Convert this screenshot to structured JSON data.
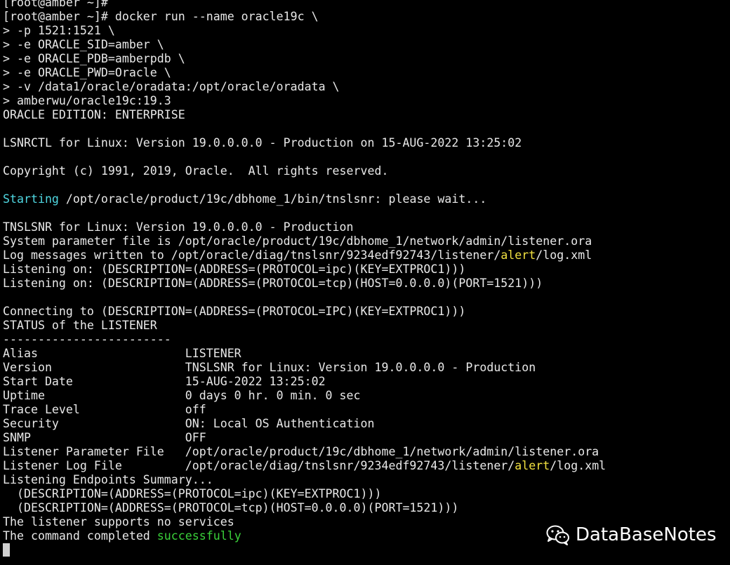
{
  "terminal": {
    "lines": [
      {
        "segments": [
          {
            "text": "[root@amber ~]#",
            "color": "default"
          }
        ]
      },
      {
        "segments": [
          {
            "text": "[root@amber ~]# docker run --name oracle19c \\",
            "color": "default"
          }
        ]
      },
      {
        "segments": [
          {
            "text": "> -p 1521:1521 \\",
            "color": "default"
          }
        ]
      },
      {
        "segments": [
          {
            "text": "> -e ORACLE_SID=amber \\",
            "color": "default"
          }
        ]
      },
      {
        "segments": [
          {
            "text": "> -e ORACLE_PDB=amberpdb \\",
            "color": "default"
          }
        ]
      },
      {
        "segments": [
          {
            "text": "> -e ORACLE_PWD=Oracle \\",
            "color": "default"
          }
        ]
      },
      {
        "segments": [
          {
            "text": "> -v /data1/oracle/oradata:/opt/oracle/oradata \\",
            "color": "default"
          }
        ]
      },
      {
        "segments": [
          {
            "text": "> amberwu/oracle19c:19.3",
            "color": "default"
          }
        ]
      },
      {
        "segments": [
          {
            "text": "ORACLE EDITION: ENTERPRISE",
            "color": "default"
          }
        ]
      },
      {
        "segments": [
          {
            "text": "",
            "color": "default"
          }
        ]
      },
      {
        "segments": [
          {
            "text": "LSNRCTL for Linux: Version 19.0.0.0.0 - Production on 15-AUG-2022 13:25:02",
            "color": "default"
          }
        ]
      },
      {
        "segments": [
          {
            "text": "",
            "color": "default"
          }
        ]
      },
      {
        "segments": [
          {
            "text": "Copyright (c) 1991, 2019, Oracle.  All rights reserved.",
            "color": "default"
          }
        ]
      },
      {
        "segments": [
          {
            "text": "",
            "color": "default"
          }
        ]
      },
      {
        "segments": [
          {
            "text": "Starting",
            "color": "cyan"
          },
          {
            "text": " /opt/oracle/product/19c/dbhome_1/bin/tnslsnr: please wait...",
            "color": "default"
          }
        ]
      },
      {
        "segments": [
          {
            "text": "",
            "color": "default"
          }
        ]
      },
      {
        "segments": [
          {
            "text": "TNSLSNR for Linux: Version 19.0.0.0.0 - Production",
            "color": "default"
          }
        ]
      },
      {
        "segments": [
          {
            "text": "System parameter file is /opt/oracle/product/19c/dbhome_1/network/admin/listener.ora",
            "color": "default"
          }
        ]
      },
      {
        "segments": [
          {
            "text": "Log messages written to /opt/oracle/diag/tnslsnr/9234edf92743/listener/",
            "color": "default"
          },
          {
            "text": "alert",
            "color": "yellow"
          },
          {
            "text": "/log.xml",
            "color": "default"
          }
        ]
      },
      {
        "segments": [
          {
            "text": "Listening on: (DESCRIPTION=(ADDRESS=(PROTOCOL=ipc)(KEY=EXTPROC1)))",
            "color": "default"
          }
        ]
      },
      {
        "segments": [
          {
            "text": "Listening on: (DESCRIPTION=(ADDRESS=(PROTOCOL=tcp)(HOST=0.0.0.0)(PORT=1521)))",
            "color": "default"
          }
        ]
      },
      {
        "segments": [
          {
            "text": "",
            "color": "default"
          }
        ]
      },
      {
        "segments": [
          {
            "text": "Connecting to (DESCRIPTION=(ADDRESS=(PROTOCOL=IPC)(KEY=EXTPROC1)))",
            "color": "default"
          }
        ]
      },
      {
        "segments": [
          {
            "text": "STATUS of the LISTENER",
            "color": "default"
          }
        ]
      },
      {
        "segments": [
          {
            "text": "------------------------",
            "color": "default"
          }
        ]
      },
      {
        "segments": [
          {
            "text": "Alias                     LISTENER",
            "color": "default"
          }
        ]
      },
      {
        "segments": [
          {
            "text": "Version                   TNSLSNR for Linux: Version 19.0.0.0.0 - Production",
            "color": "default"
          }
        ]
      },
      {
        "segments": [
          {
            "text": "Start Date                15-AUG-2022 13:25:02",
            "color": "default"
          }
        ]
      },
      {
        "segments": [
          {
            "text": "Uptime                    0 days 0 hr. 0 min. 0 sec",
            "color": "default"
          }
        ]
      },
      {
        "segments": [
          {
            "text": "Trace Level               off",
            "color": "default"
          }
        ]
      },
      {
        "segments": [
          {
            "text": "Security                  ON: Local OS Authentication",
            "color": "default"
          }
        ]
      },
      {
        "segments": [
          {
            "text": "SNMP                      OFF",
            "color": "default"
          }
        ]
      },
      {
        "segments": [
          {
            "text": "Listener Parameter File   /opt/oracle/product/19c/dbhome_1/network/admin/listener.ora",
            "color": "default"
          }
        ]
      },
      {
        "segments": [
          {
            "text": "Listener Log File         /opt/oracle/diag/tnslsnr/9234edf92743/listener/",
            "color": "default"
          },
          {
            "text": "alert",
            "color": "yellow"
          },
          {
            "text": "/log.xml",
            "color": "default"
          }
        ]
      },
      {
        "segments": [
          {
            "text": "Listening Endpoints Summary...",
            "color": "default"
          }
        ]
      },
      {
        "segments": [
          {
            "text": "  (DESCRIPTION=(ADDRESS=(PROTOCOL=ipc)(KEY=EXTPROC1)))",
            "color": "default"
          }
        ]
      },
      {
        "segments": [
          {
            "text": "  (DESCRIPTION=(ADDRESS=(PROTOCOL=tcp)(HOST=0.0.0.0)(PORT=1521)))",
            "color": "default"
          }
        ]
      },
      {
        "segments": [
          {
            "text": "The listener supports no services",
            "color": "default"
          }
        ]
      },
      {
        "segments": [
          {
            "text": "The command completed ",
            "color": "default"
          },
          {
            "text": "successfully",
            "color": "green"
          }
        ]
      }
    ],
    "colors": {
      "background": "#000000",
      "default": "#e8e8e8",
      "cyan": "#4fd6e0",
      "yellow": "#f0e040",
      "green": "#3ad13a",
      "cursor": "#d0d0d0"
    }
  },
  "watermark": {
    "icon": "wechat-icon",
    "text": "DataBaseNotes"
  }
}
